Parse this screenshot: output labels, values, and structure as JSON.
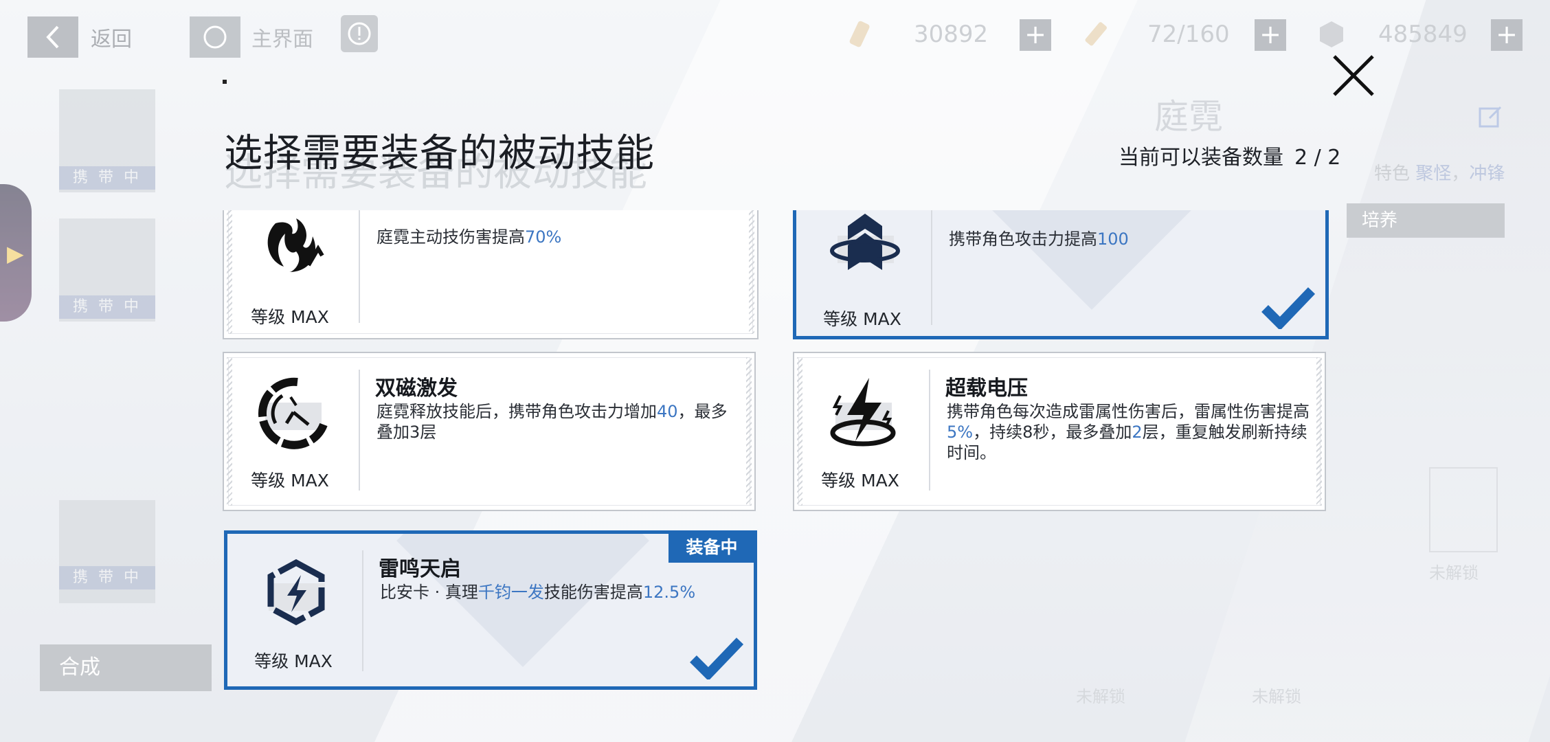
{
  "topbar": {
    "back_label": "返回",
    "home_label": "主界面",
    "resources": [
      {
        "icon": "stamina-icon",
        "value": "30892"
      },
      {
        "icon": "energy-icon",
        "value": "72/160"
      },
      {
        "icon": "coin-icon",
        "value": "485849"
      }
    ]
  },
  "left_rail": {
    "tags": [
      "携 带 中",
      "携 带 中",
      "携 带 中"
    ],
    "compose_label": "合成"
  },
  "right_panel": {
    "title": "庭霓",
    "tags_prefix": "特色",
    "tag1": "聚怪",
    "tag2": "冲锋",
    "train_label": "培养",
    "unlock_labels": [
      "未解锁",
      "未解锁",
      "未解锁"
    ]
  },
  "modal": {
    "title": "选择需要装备的被动技能",
    "count_label": "当前可以装备数量",
    "count_value": "2 / 2",
    "equipped_tag": "装备中",
    "skills": [
      {
        "name": "",
        "level": "等级  MAX",
        "icon": "fire-swirl-icon",
        "desc_pre": "庭霓主动技伤害提高",
        "desc_hl": "70%",
        "desc_post": "",
        "selected": false
      },
      {
        "name": "",
        "level": "等级  MAX",
        "icon": "chevron-emblem-icon",
        "desc_pre": "携带角色攻击力提高",
        "desc_hl": "100",
        "desc_post": "",
        "selected": true
      },
      {
        "name": "双磁激发",
        "level": "等级  MAX",
        "icon": "gauge-icon",
        "desc_pre": "庭霓释放技能后，携带角色攻击力增加",
        "desc_hl": "40",
        "desc_post": "，最多叠加3层",
        "selected": false
      },
      {
        "name": "超载电压",
        "level": "等级  MAX",
        "icon": "lightning-ring-icon",
        "desc_pre": "携带角色每次造成雷属性伤害后，雷属性伤害提高",
        "desc_hl": "5%",
        "desc_mid": "，持续8秒，最多叠加",
        "desc_hl2": "2",
        "desc_post": "层，重复触发刷新持续时间。",
        "selected": false
      },
      {
        "name": "雷鸣天启",
        "level": "等级  MAX",
        "icon": "hex-lightning-icon",
        "desc_pre": "比安卡 · 真理",
        "desc_hl": "千钧一发",
        "desc_mid": "技能伤害提高",
        "desc_hl2": "12.5%",
        "desc_post": "",
        "selected": true
      }
    ]
  },
  "colors": {
    "accent": "#1f68b6",
    "highlight": "#3c76c2"
  }
}
